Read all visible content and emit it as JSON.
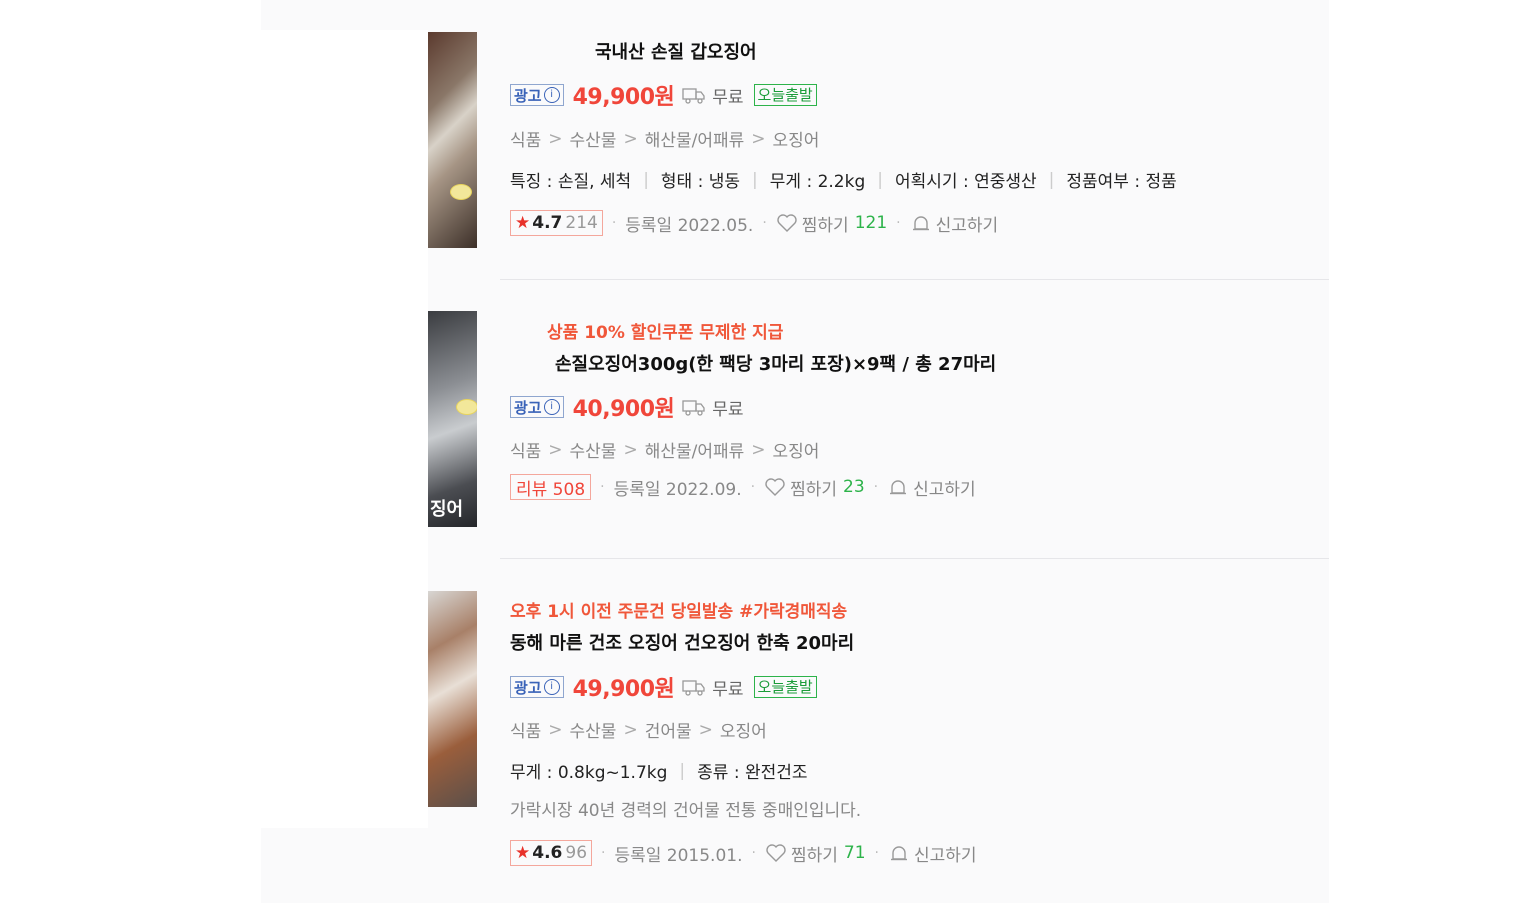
{
  "items": [
    {
      "promo": "",
      "title": "국내산 손질 갑오징어",
      "ad_label": "광고",
      "price": "49,900원",
      "shipping": "무료",
      "today_badge": "오늘출발",
      "category": [
        "식품",
        "수산물",
        "해산물/어패류",
        "오징어"
      ],
      "specs": [
        "특징 : 손질, 세척",
        "형태 : 냉동",
        "무게 : 2.2kg",
        "어획시기 : 연중생산",
        "정품여부 : 정품"
      ],
      "description": "",
      "rating_star": "★",
      "rating": "4.7",
      "rating_count": "214",
      "review_label": "",
      "registered": "등록일 2022.05.",
      "wish_label": "찜하기",
      "wish_count": "121",
      "report_label": "신고하기"
    },
    {
      "promo": "상품 10% 할인쿠폰 무제한 지급",
      "title": "손질오징어300g(한 팩당 3마리 포장)×9팩 / 총 27마리",
      "ad_label": "광고",
      "price": "40,900원",
      "shipping": "무료",
      "today_badge": "",
      "category": [
        "식품",
        "수산물",
        "해산물/어패류",
        "오징어"
      ],
      "specs": [],
      "description": "",
      "rating_star": "",
      "rating": "",
      "rating_count": "",
      "review_label": "리뷰 508",
      "registered": "등록일 2022.09.",
      "wish_label": "찜하기",
      "wish_count": "23",
      "report_label": "신고하기",
      "thumb_text": "징어"
    },
    {
      "promo": "오후 1시 이전 주문건 당일발송 #가락경매직송",
      "title": "동해 마른 건조 오징어 건오징어 한축 20마리",
      "ad_label": "광고",
      "price": "49,900원",
      "shipping": "무료",
      "today_badge": "오늘출발",
      "category": [
        "식품",
        "수산물",
        "건어물",
        "오징어"
      ],
      "specs": [
        "무게 : 0.8kg~1.7kg",
        "종류 : 완전건조"
      ],
      "description": "가락시장 40년 경력의 건어물 전통 중매인입니다.",
      "rating_star": "★",
      "rating": "4.6",
      "rating_count": "96",
      "review_label": "",
      "registered": "등록일 2015.01.",
      "wish_label": "찜하기",
      "wish_count": "71",
      "report_label": "신고하기"
    }
  ],
  "colors": {
    "price": "#f0463a",
    "promo": "#f0573a",
    "today": "#2db34a",
    "ad": "#3a63b8"
  },
  "icons": {
    "truck": "truck-icon",
    "heart": "heart-icon",
    "report": "bell-report-icon",
    "info": "info-icon"
  }
}
